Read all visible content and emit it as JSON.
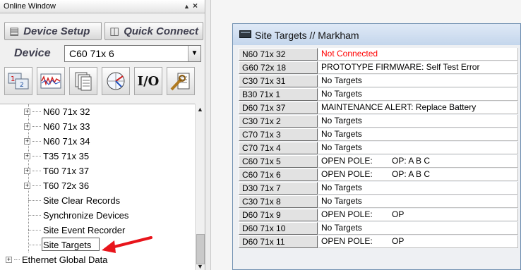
{
  "panel": {
    "title": "Online Window",
    "pin_symbol": "▲",
    "close_symbol": "×"
  },
  "toolbar": {
    "device_setup_label": "Device Setup",
    "quick_connect_label": "Quick Connect"
  },
  "device": {
    "label": "Device",
    "selected": "C60 71x 6"
  },
  "icon_toolbar": [
    "actual-values-icon",
    "waveform-icon",
    "records-icon",
    "metering-icon",
    "io-icon",
    "settings-icon"
  ],
  "io_label": "I/O",
  "tree": {
    "devices": [
      "N60 71x 32",
      "N60 71x 33",
      "N60 71x 34",
      "T35 71x 35",
      "T60 71x 37",
      "T60 72x 36"
    ],
    "site_items": [
      "Site Clear Records",
      "Synchronize Devices",
      "Site Event Recorder",
      "Site Targets"
    ],
    "bottom_item": "Ethernet Global Data"
  },
  "site_window": {
    "title": "Site Targets // Markham"
  },
  "targets": [
    {
      "device": "N60 71x 32",
      "status": "Not Connected",
      "detail": "",
      "color": "#ff0000"
    },
    {
      "device": "G60 72x 18",
      "status": "PROTOTYPE FIRMWARE: Self Test Error",
      "detail": "",
      "color": "#000000"
    },
    {
      "device": "C30 71x 31",
      "status": "No Targets",
      "detail": "",
      "color": "#000000"
    },
    {
      "device": "B30 71x 1",
      "status": "No Targets",
      "detail": "",
      "color": "#000000"
    },
    {
      "device": "D60 71x 37",
      "status": "MAINTENANCE ALERT:  Replace Battery",
      "detail": "",
      "color": "#000000"
    },
    {
      "device": "C30 71x 2",
      "status": "No Targets",
      "detail": "",
      "color": "#000000"
    },
    {
      "device": "C70 71x 3",
      "status": "No Targets",
      "detail": "",
      "color": "#000000"
    },
    {
      "device": "C70 71x 4",
      "status": "No Targets",
      "detail": "",
      "color": "#000000"
    },
    {
      "device": "C60 71x 5",
      "status": "OPEN POLE:",
      "detail": "OP: A B C",
      "color": "#000000"
    },
    {
      "device": "C60 71x 6",
      "status": "OPEN POLE:",
      "detail": "OP: A B C",
      "color": "#000000"
    },
    {
      "device": "D30 71x 7",
      "status": "No Targets",
      "detail": "",
      "color": "#000000"
    },
    {
      "device": "C30 71x 8",
      "status": "No Targets",
      "detail": "",
      "color": "#000000"
    },
    {
      "device": "D60 71x 9",
      "status": "OPEN POLE:",
      "detail": "OP",
      "color": "#000000"
    },
    {
      "device": "D60 71x 10",
      "status": "No Targets",
      "detail": "",
      "color": "#000000"
    },
    {
      "device": "D60 71x 11",
      "status": "OPEN POLE:",
      "detail": "OP",
      "color": "#000000"
    }
  ],
  "colors": {
    "arrow": "#e8141b",
    "not_connected": "#ff0000",
    "window_border": "#6e8eb0"
  }
}
